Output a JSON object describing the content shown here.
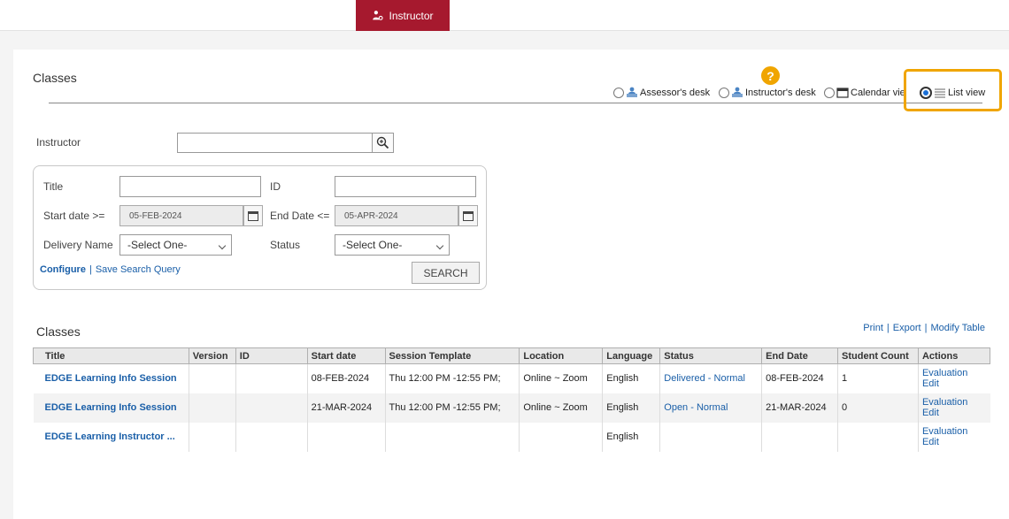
{
  "topnav": {
    "tab_label": "Instructor"
  },
  "page": {
    "title": "Classes",
    "help": "?"
  },
  "view_options": [
    {
      "label": "Assessor's desk",
      "icon": "desk-user-icon",
      "selected": false
    },
    {
      "label": "Instructor's desk",
      "icon": "desk-user-icon",
      "selected": false
    },
    {
      "label": "Calendar view",
      "icon": "calendar-icon",
      "selected": false
    },
    {
      "label": "List view",
      "icon": "list-icon",
      "selected": true
    }
  ],
  "filters": {
    "instructor_label": "Instructor",
    "instructor_value": "",
    "title_label": "Title",
    "id_label": "ID",
    "start_date_label": "Start date >=",
    "start_date_value": "05-FEB-2024",
    "end_date_label": "End Date <=",
    "end_date_value": "05-APR-2024",
    "delivery_label": "Delivery Name",
    "delivery_value": "-Select One-",
    "status_label": "Status",
    "status_value": "-Select One-",
    "configure_link": "Configure",
    "save_query_link": "Save Search Query",
    "search_button": "SEARCH"
  },
  "results": {
    "heading": "Classes",
    "links": {
      "print": "Print",
      "export": "Export",
      "modify": "Modify Table"
    },
    "columns": [
      "Title",
      "Version",
      "ID",
      "Start date",
      "Session Template",
      "Location",
      "Language",
      "Status",
      "End Date",
      "Student Count",
      "Actions"
    ],
    "rows": [
      {
        "title": "EDGE Learning Info Session",
        "version": "",
        "id": "",
        "start": "08-FEB-2024",
        "template": "Thu 12:00 PM -12:55 PM;",
        "location": "Online ~ Zoom",
        "language": "English",
        "status": "Delivered - Normal",
        "end": "08-FEB-2024",
        "count": "1",
        "action1": "Evaluation",
        "action2": "Edit"
      },
      {
        "title": "EDGE Learning Info Session",
        "version": "",
        "id": "",
        "start": "21-MAR-2024",
        "template": "Thu 12:00 PM -12:55 PM;",
        "location": "Online ~ Zoom",
        "language": "English",
        "status": "Open - Normal",
        "end": "21-MAR-2024",
        "count": "0",
        "action1": "Evaluation",
        "action2": "Edit"
      },
      {
        "title": "EDGE Learning Instructor ...",
        "version": "",
        "id": "",
        "start": "",
        "template": "",
        "location": "",
        "language": "English",
        "status": "",
        "end": "",
        "count": "",
        "action1": "Evaluation",
        "action2": "Edit"
      }
    ]
  },
  "colors": {
    "brand": "#a6192e",
    "highlight": "#f0a500",
    "link": "#1a5fa8"
  }
}
